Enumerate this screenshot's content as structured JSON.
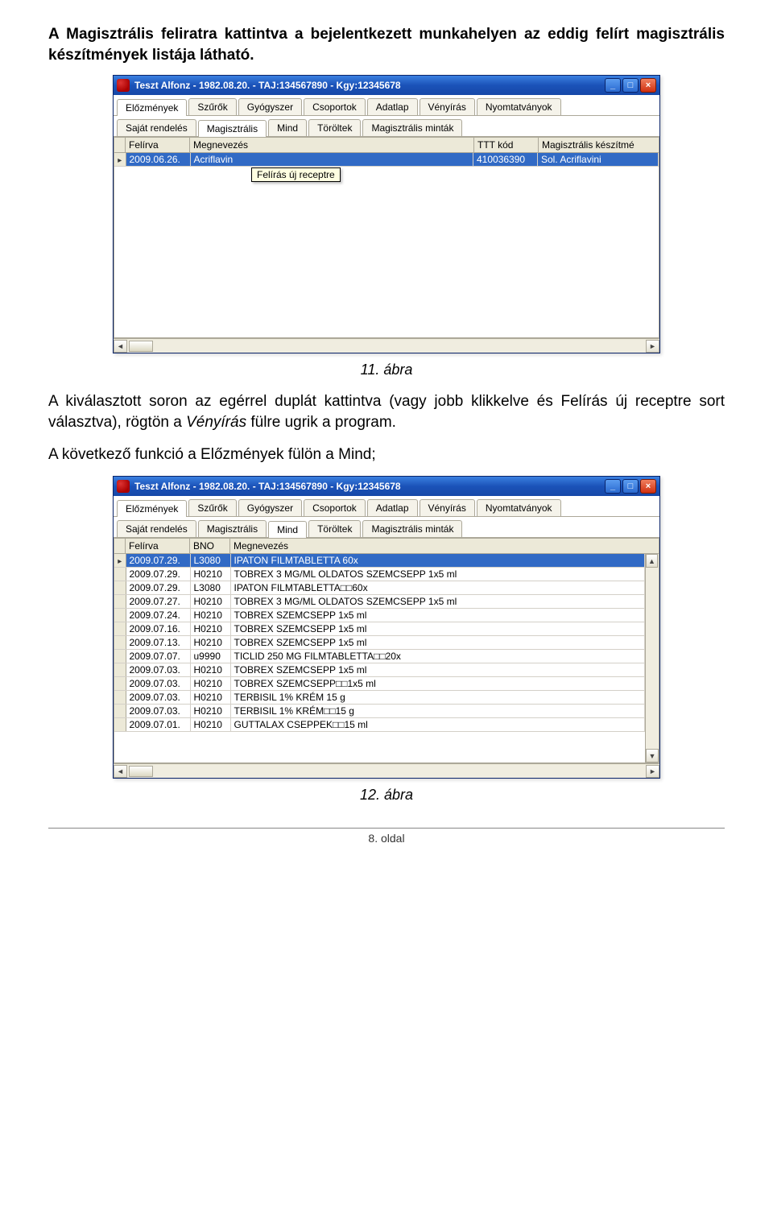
{
  "para1": "A Magisztrális feliratra kattintva a bejelentkezett munkahelyen az eddig felírt magisztrális készítmények listája látható.",
  "caption1": "11. ábra",
  "para2_pre": "A kiválasztott soron az egérrel duplát kattintva (vagy jobb klikkelve és Felírás új receptre sort választva), rögtön a ",
  "para2_em": "Vényírás",
  "para2_post": " fülre ugrik a program.",
  "para3": "A következő funkció a Előzmények fülön a Mind;",
  "caption2": "12. ábra",
  "footer": "8. oldal",
  "win1": {
    "title": "Teszt Alfonz - 1982.08.20. - TAJ:134567890 - Kgy:12345678",
    "tabs_top": [
      "Előzmények",
      "Szűrők",
      "Gyógyszer",
      "Csoportok",
      "Adatlap",
      "Vényírás",
      "Nyomtatványok"
    ],
    "tabs_sub": [
      "Saját rendelés",
      "Magisztrális",
      "Mind",
      "Töröltek",
      "Magisztrális minták"
    ],
    "active_sub": 1,
    "cols": {
      "felirva": "Felírva",
      "megnevezes": "Megnevezés",
      "ttt": "TTT kód",
      "mag": "Magisztrális készítmé"
    },
    "row": {
      "date": "2009.06.26.",
      "name": "Acriflavin",
      "ttt": "410036390",
      "mag": "Sol. Acriflavini"
    },
    "tooltip": "Felírás új receptre"
  },
  "win2": {
    "title": "Teszt Alfonz - 1982.08.20. - TAJ:134567890 - Kgy:12345678",
    "tabs_top": [
      "Előzmények",
      "Szűrők",
      "Gyógyszer",
      "Csoportok",
      "Adatlap",
      "Vényírás",
      "Nyomtatványok"
    ],
    "tabs_sub": [
      "Saját rendelés",
      "Magisztrális",
      "Mind",
      "Töröltek",
      "Magisztrális minták"
    ],
    "active_sub": 2,
    "cols": {
      "felirva": "Felírva",
      "bno": "BNO",
      "megnevezes": "Megnevezés"
    },
    "rows": [
      {
        "date": "2009.07.29.",
        "bno": "L3080",
        "name": "IPATON FILMTABLETTA 60x",
        "sel": true
      },
      {
        "date": "2009.07.29.",
        "bno": "H0210",
        "name": "TOBREX 3 MG/ML OLDATOS SZEMCSEPP 1x5 ml"
      },
      {
        "date": "2009.07.29.",
        "bno": "L3080",
        "name": "IPATON FILMTABLETTA□□60x"
      },
      {
        "date": "2009.07.27.",
        "bno": "H0210",
        "name": "TOBREX 3 MG/ML OLDATOS SZEMCSEPP 1x5 ml"
      },
      {
        "date": "2009.07.24.",
        "bno": "H0210",
        "name": "TOBREX SZEMCSEPP 1x5 ml"
      },
      {
        "date": "2009.07.16.",
        "bno": "H0210",
        "name": "TOBREX SZEMCSEPP 1x5 ml"
      },
      {
        "date": "2009.07.13.",
        "bno": "H0210",
        "name": "TOBREX SZEMCSEPP 1x5 ml"
      },
      {
        "date": "2009.07.07.",
        "bno": "u9990",
        "name": "TICLID 250 MG FILMTABLETTA□□20x"
      },
      {
        "date": "2009.07.03.",
        "bno": "H0210",
        "name": "TOBREX SZEMCSEPP 1x5 ml"
      },
      {
        "date": "2009.07.03.",
        "bno": "H0210",
        "name": "TOBREX SZEMCSEPP□□1x5 ml"
      },
      {
        "date": "2009.07.03.",
        "bno": "H0210",
        "name": "TERBISIL 1% KRÉM 15 g"
      },
      {
        "date": "2009.07.03.",
        "bno": "H0210",
        "name": "TERBISIL 1% KRÉM□□15 g"
      },
      {
        "date": "2009.07.01.",
        "bno": "H0210",
        "name": "GUTTALAX CSEPPEK□□15 ml"
      }
    ]
  }
}
